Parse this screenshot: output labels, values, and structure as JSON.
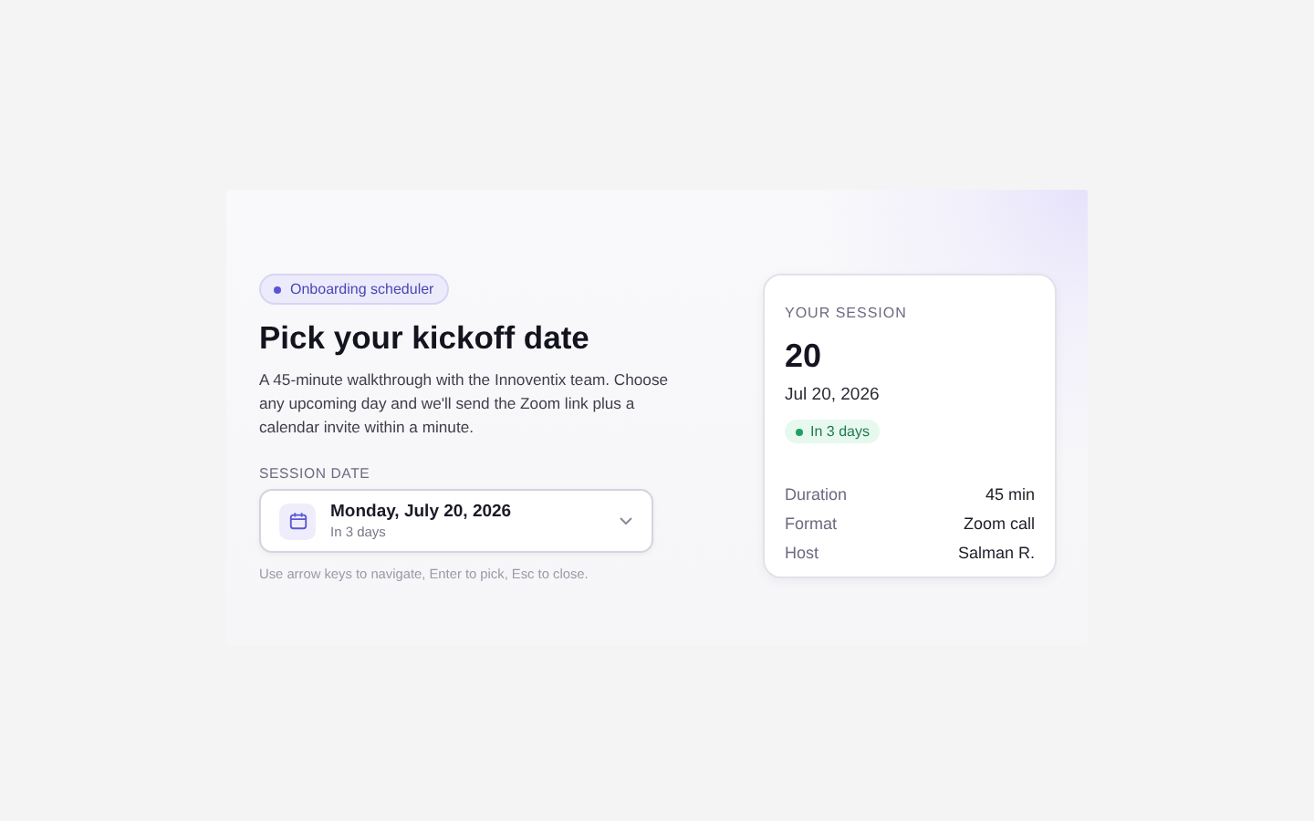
{
  "badge": {
    "label": "Onboarding scheduler"
  },
  "heading": "Pick your kickoff date",
  "description": "A 45-minute walkthrough with the Innoventix team. Choose any upcoming day and we'll send the Zoom link plus a calendar invite within a minute.",
  "date_field": {
    "label": "SESSION DATE",
    "value": "Monday, July 20, 2026",
    "subtitle": "In 3 days",
    "expanded": false
  },
  "hint": "Use arrow keys to navigate, Enter to pick, Esc to close.",
  "session": {
    "title": "YOUR SESSION",
    "day": "20",
    "date": "Jul 20, 2026",
    "relative": "In 3 days",
    "details": [
      {
        "label": "Duration",
        "value": "45 min"
      },
      {
        "label": "Format",
        "value": "Zoom call"
      },
      {
        "label": "Host",
        "value": "Salman R."
      }
    ]
  }
}
